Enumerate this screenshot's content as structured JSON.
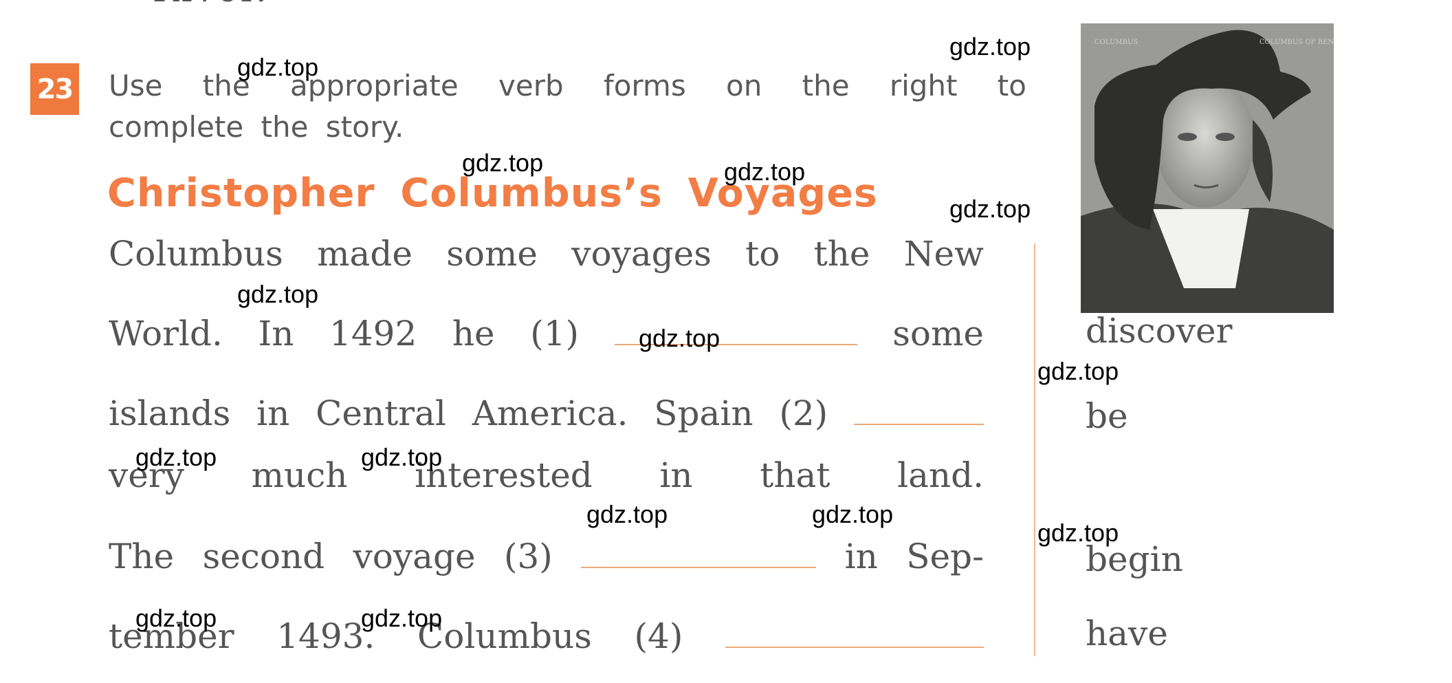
{
  "previous_text_fragment": "River.",
  "exercise": {
    "number": "23",
    "instruction_line1": [
      "Use",
      "the",
      "appropriate",
      "verb",
      "forms",
      "on",
      "the",
      "right",
      "to"
    ],
    "instruction_line2": "complete the story.",
    "title": "Christopher Columbus’s Voyages"
  },
  "story_lines": [
    [
      "Columbus",
      "made",
      "some",
      "voyages",
      "to",
      "the",
      "New"
    ],
    [
      "World.",
      "In",
      "1492",
      "he",
      "(1)",
      {
        "blank": 1
      },
      "some"
    ],
    [
      "islands",
      "in",
      "Central",
      "America.",
      "Spain",
      "(2)",
      {
        "blank": 2
      }
    ],
    [
      "very",
      "much",
      "interested",
      "in",
      "that",
      "land."
    ],
    [
      "The",
      "second",
      "voyage",
      "(3)",
      {
        "blank": 3
      },
      "in",
      "Sep-"
    ],
    [
      "tember",
      "1493.",
      "Columbus",
      "(4)",
      {
        "blank": 4
      }
    ]
  ],
  "verbs": [
    "discover",
    "be",
    "begin",
    "have"
  ],
  "portrait": {
    "subject": "Christopher Columbus portrait",
    "caption_left": "COLUMBUS",
    "caption_right": "COLUMBUS OF BEN"
  },
  "watermark": "gdz.top",
  "colors": {
    "accent": "#f27d45",
    "text": "#555555"
  }
}
